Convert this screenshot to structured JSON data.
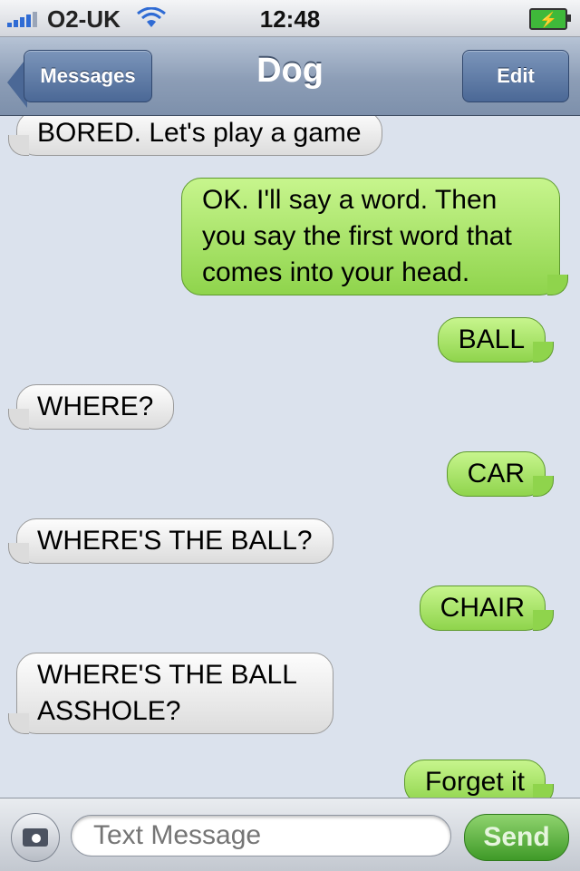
{
  "status_bar": {
    "carrier": "O2-UK",
    "time": "12:48",
    "signal_icon": "signal-bars-icon",
    "wifi_icon": "wifi-icon",
    "battery_icon": "battery-charging-icon"
  },
  "nav": {
    "back_label": "Messages",
    "title": "Dog",
    "edit_label": "Edit"
  },
  "messages": [
    {
      "direction": "incoming",
      "text": "BORED. Let's play a game"
    },
    {
      "direction": "outgoing",
      "text": "OK. I'll say a word. Then you say the first word that comes into your head."
    },
    {
      "direction": "outgoing",
      "text": "BALL"
    },
    {
      "direction": "incoming",
      "text": "WHERE?"
    },
    {
      "direction": "outgoing",
      "text": "CAR"
    },
    {
      "direction": "incoming",
      "text": "WHERE'S THE BALL?"
    },
    {
      "direction": "outgoing",
      "text": "CHAIR"
    },
    {
      "direction": "incoming",
      "text": "WHERE'S THE BALL ASSHOLE?"
    },
    {
      "direction": "outgoing",
      "text": "Forget it"
    }
  ],
  "input": {
    "placeholder": "Text Message",
    "value": "",
    "camera_icon": "camera-icon",
    "send_label": "Send"
  },
  "colors": {
    "incoming_bubble": "#e8e8e8",
    "outgoing_bubble": "#9edb5a",
    "nav_bar": "#8c9db6",
    "background": "#dbe2ed"
  }
}
